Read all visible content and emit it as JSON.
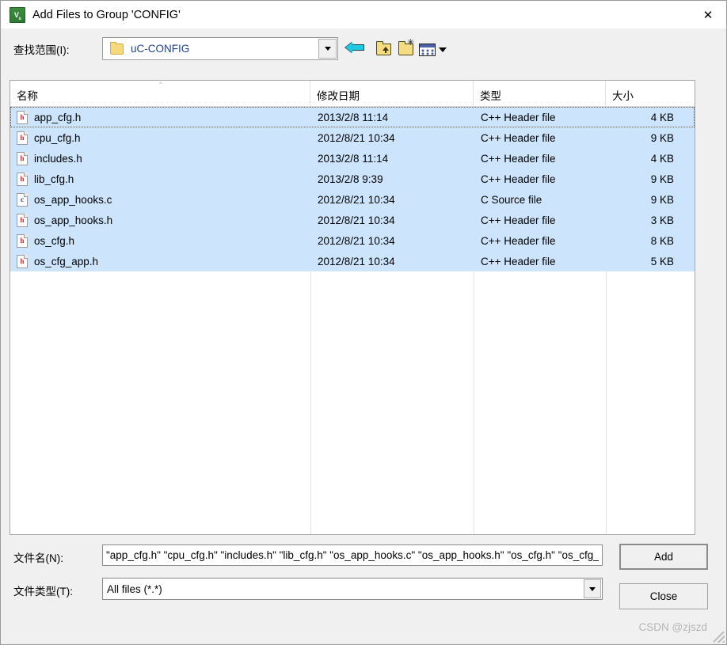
{
  "window": {
    "title": "Add Files to Group 'CONFIG'",
    "app_icon": "uvision-icon",
    "close_label": "✕"
  },
  "lookin": {
    "label": "查找范围(I):",
    "value": "uC-CONFIG",
    "folder_icon": "folder-icon",
    "dropdown_icon": "chevron-down-icon"
  },
  "toolbar": {
    "back_icon": "back-arrow-icon",
    "up_icon": "up-folder-icon",
    "new_folder_icon": "new-folder-icon",
    "views_icon": "views-icon",
    "views_dropdown_icon": "chevron-down-icon"
  },
  "filelist": {
    "sort_indicator": "˄",
    "columns": [
      {
        "label": "名称",
        "key": "name"
      },
      {
        "label": "修改日期",
        "key": "date"
      },
      {
        "label": "类型",
        "key": "type"
      },
      {
        "label": "大小",
        "key": "size"
      }
    ],
    "rows": [
      {
        "icon": "h",
        "name": "app_cfg.h",
        "date": "2013/2/8 11:14",
        "type": "C++ Header file",
        "size": "4 KB",
        "selected": true,
        "focused": true
      },
      {
        "icon": "h",
        "name": "cpu_cfg.h",
        "date": "2012/8/21 10:34",
        "type": "C++ Header file",
        "size": "9 KB",
        "selected": true,
        "focused": false
      },
      {
        "icon": "h",
        "name": "includes.h",
        "date": "2013/2/8 11:14",
        "type": "C++ Header file",
        "size": "4 KB",
        "selected": true,
        "focused": false
      },
      {
        "icon": "h",
        "name": "lib_cfg.h",
        "date": "2013/2/8 9:39",
        "type": "C++ Header file",
        "size": "9 KB",
        "selected": true,
        "focused": false
      },
      {
        "icon": "c",
        "name": "os_app_hooks.c",
        "date": "2012/8/21 10:34",
        "type": "C Source file",
        "size": "9 KB",
        "selected": true,
        "focused": false
      },
      {
        "icon": "h",
        "name": "os_app_hooks.h",
        "date": "2012/8/21 10:34",
        "type": "C++ Header file",
        "size": "3 KB",
        "selected": true,
        "focused": false
      },
      {
        "icon": "h",
        "name": "os_cfg.h",
        "date": "2012/8/21 10:34",
        "type": "C++ Header file",
        "size": "8 KB",
        "selected": true,
        "focused": false
      },
      {
        "icon": "h",
        "name": "os_cfg_app.h",
        "date": "2012/8/21 10:34",
        "type": "C++ Header file",
        "size": "5 KB",
        "selected": true,
        "focused": false
      }
    ]
  },
  "form": {
    "filename_label": "文件名(N):",
    "filename_value": "\"app_cfg.h\" \"cpu_cfg.h\" \"includes.h\" \"lib_cfg.h\" \"os_app_hooks.c\" \"os_app_hooks.h\" \"os_cfg.h\" \"os_cfg_app.h\"",
    "filename_placeholder": "",
    "filetype_label": "文件类型(T):",
    "filetype_value": "All files (*.*)",
    "filetype_dropdown_icon": "chevron-down-icon"
  },
  "buttons": {
    "add_label": "Add",
    "close_label": "Close"
  },
  "watermark": "CSDN @zjszd",
  "colors": {
    "selection": "#cce4fc",
    "dialog_bg": "#f0f0f0",
    "titlebar_bg": "#ffffff",
    "folder_yellow": "#f6d97c",
    "back_arrow_cyan": "#1ec8e0",
    "header_icon_red": "#d0232b",
    "source_icon_blue": "#2d3fb0",
    "link_text": "#21428a"
  }
}
